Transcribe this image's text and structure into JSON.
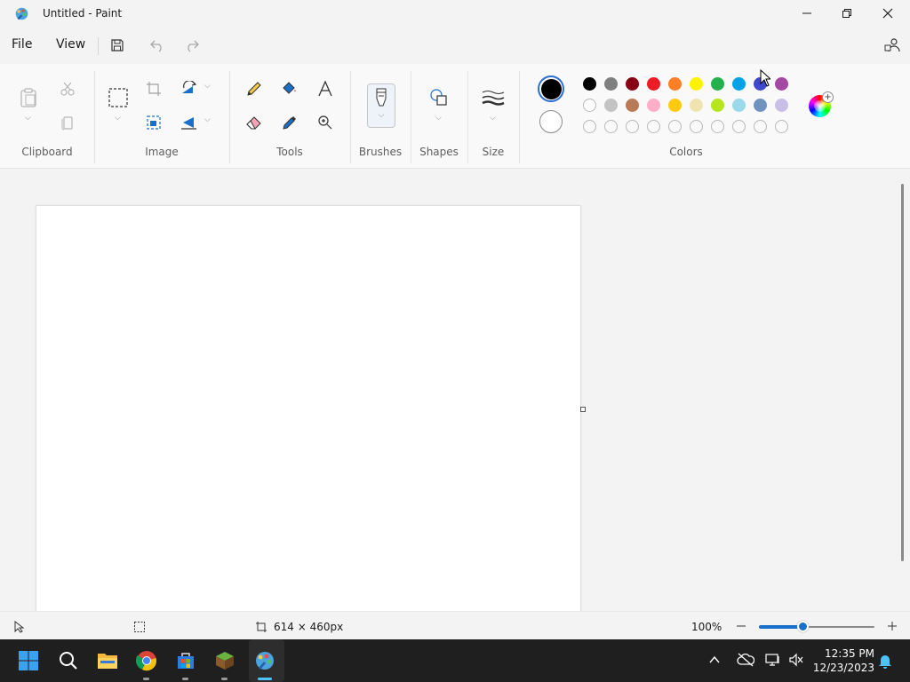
{
  "window": {
    "title": "Untitled - Paint"
  },
  "menu": {
    "file": "File",
    "view": "View"
  },
  "ribbon": {
    "groups": {
      "clipboard": "Clipboard",
      "image": "Image",
      "tools": "Tools",
      "brushes": "Brushes",
      "shapes": "Shapes",
      "size": "Size",
      "colors": "Colors"
    }
  },
  "colors": {
    "primary": "#000000",
    "secondary": "#ffffff",
    "palette_row1": [
      "#000000",
      "#7f7f7f",
      "#880015",
      "#ed1c24",
      "#ff7f27",
      "#fff200",
      "#22b14c",
      "#00a2e8",
      "#3f48cc",
      "#a349a4"
    ],
    "palette_row2": [
      "#ffffff",
      "#c3c3c3",
      "#b97a57",
      "#ffaec9",
      "#ffc90e",
      "#efe4b0",
      "#b5e61d",
      "#99d9ea",
      "#7092be",
      "#c8bfe7"
    ],
    "palette_row3": [
      "empty",
      "empty",
      "empty",
      "empty",
      "empty",
      "empty",
      "empty",
      "empty",
      "empty",
      "empty"
    ]
  },
  "status": {
    "canvas_size": "614 × 460px",
    "zoom": "100%",
    "zoom_fraction": 0.38
  },
  "taskbar": {
    "time": "12:35 PM",
    "date": "12/23/2023",
    "apps": [
      "windows-start-icon",
      "search-icon",
      "file-explorer-icon",
      "chrome-icon",
      "microsoft-store-icon",
      "minecraft-icon",
      "paint-icon"
    ]
  }
}
